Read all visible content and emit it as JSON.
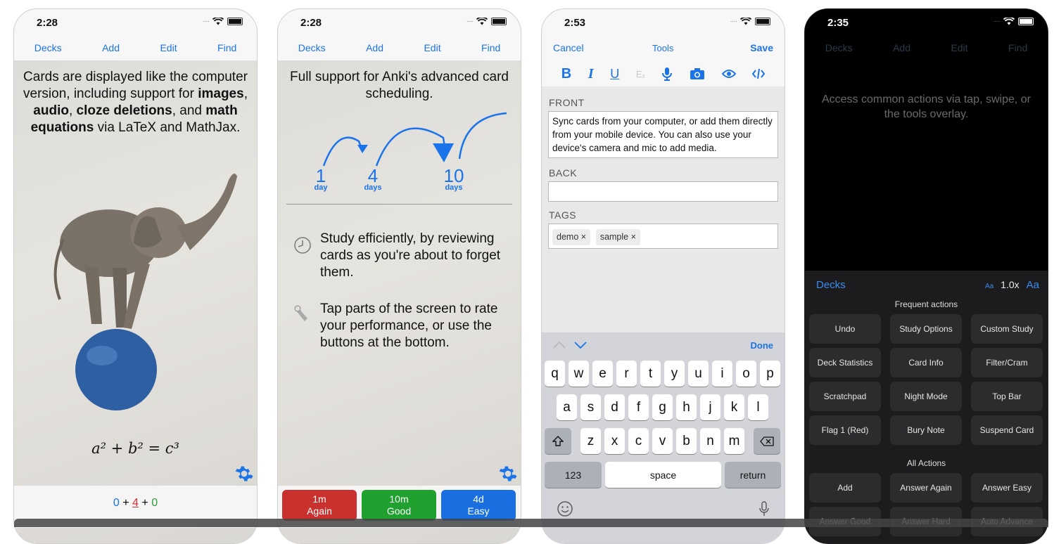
{
  "colors": {
    "accent": "#1a73e8",
    "again": "#c8312e",
    "good": "#1fa02f",
    "easy": "#1a6fe0"
  },
  "screen1": {
    "time": "2:28",
    "nav": [
      "Decks",
      "Add",
      "Edit",
      "Find"
    ],
    "text_parts": [
      "Cards are displayed like the computer version, including support for ",
      "images",
      ", ",
      "audio",
      ", ",
      "cloze deletions",
      ", and ",
      "math equations",
      " via LaTeX and MathJax."
    ],
    "equation": "a² + b² = c³",
    "counts": {
      "new": "0",
      "plus1": "+",
      "learn": "4",
      "plus2": "+",
      "review": "0"
    }
  },
  "screen2": {
    "time": "2:28",
    "nav": [
      "Decks",
      "Add",
      "Edit",
      "Find"
    ],
    "title": "Full support for Anki's advanced card scheduling.",
    "intervals": [
      {
        "num": "1",
        "unit": "day"
      },
      {
        "num": "4",
        "unit": "days"
      },
      {
        "num": "10",
        "unit": "days"
      }
    ],
    "tip1": "Study efficiently, by reviewing cards as you're about to forget them.",
    "tip2": "Tap parts of the screen to rate your performance, or use the buttons at the bottom.",
    "buttons": [
      {
        "time": "1m",
        "label": "Again"
      },
      {
        "time": "10m",
        "label": "Good"
      },
      {
        "time": "4d",
        "label": "Easy"
      }
    ]
  },
  "screen3": {
    "time": "2:53",
    "cancel": "Cancel",
    "tools": "Tools",
    "save": "Save",
    "toolbar": {
      "bold": "B",
      "italic": "I",
      "underline": "U",
      "clear": "Eₓ"
    },
    "front_label": "FRONT",
    "front_value": "Sync cards from your computer, or add them directly from your mobile device. You can also use your device's camera and mic to add media.",
    "back_label": "BACK",
    "back_value": "",
    "tags_label": "TAGS",
    "tags": [
      "demo ×",
      "sample ×"
    ],
    "done": "Done",
    "rows": [
      [
        "q",
        "w",
        "e",
        "r",
        "t",
        "y",
        "u",
        "i",
        "o",
        "p"
      ],
      [
        "a",
        "s",
        "d",
        "f",
        "g",
        "h",
        "j",
        "k",
        "l"
      ],
      [
        "z",
        "x",
        "c",
        "v",
        "b",
        "n",
        "m"
      ]
    ],
    "key_123": "123",
    "key_space": "space",
    "key_return": "return"
  },
  "screen4": {
    "time": "2:35",
    "nav": [
      "Decks",
      "Add",
      "Edit",
      "Find"
    ],
    "message": "Access common actions via tap, swipe, or the tools overlay.",
    "decks": "Decks",
    "zoom_small": "Aa",
    "zoom_value": "1.0x",
    "zoom_large": "Aa",
    "frequent_title": "Frequent actions",
    "frequent": [
      "Undo",
      "Study Options",
      "Custom Study",
      "Deck Statistics",
      "Card Info",
      "Filter/Cram",
      "Scratchpad",
      "Night Mode",
      "Top Bar",
      "Flag 1 (Red)",
      "Bury Note",
      "Suspend Card"
    ],
    "all_title": "All Actions",
    "all": [
      "Add",
      "Answer Again",
      "Answer Easy",
      "Answer Good",
      "Answer Hard",
      "Auto Advance"
    ]
  }
}
